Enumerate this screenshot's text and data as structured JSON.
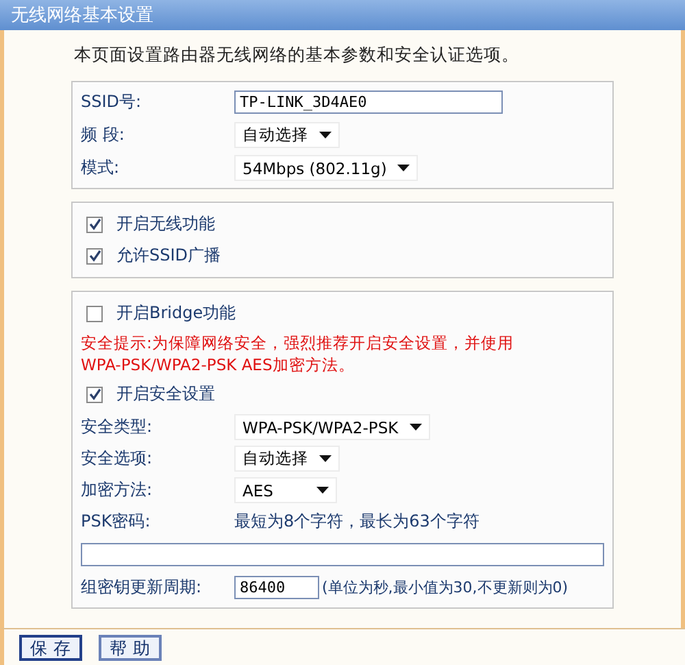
{
  "window": {
    "title": "无线网络基本设置"
  },
  "intro": "本页面设置路由器无线网络的基本参数和安全认证选项。",
  "basic": [
    {
      "kind": "text",
      "label": "SSID号:",
      "value": "TP-LINK_3D4AE0"
    },
    {
      "kind": "select",
      "label": "频 段:",
      "value": "自动选择"
    },
    {
      "kind": "select",
      "label": "模式:",
      "value": "54Mbps (802.11g)"
    }
  ],
  "switches": [
    {
      "label": "开启无线功能",
      "checked": true
    },
    {
      "label": "允许SSID广播",
      "checked": true
    }
  ],
  "bridge": {
    "label": "开启Bridge功能",
    "checked": false
  },
  "warning": [
    "安全提示:为保障网络安全，强烈推荐开启安全设置，并使用",
    "WPA-PSK/WPA2-PSK AES加密方法。"
  ],
  "security": {
    "label": "开启安全设置",
    "checked": true
  },
  "security_rows": [
    {
      "kind": "select",
      "label": "安全类型:",
      "value": "WPA-PSK/WPA2-PSK"
    },
    {
      "kind": "select",
      "label": "安全选项:",
      "value": "自动选择"
    },
    {
      "kind": "select",
      "label": "加密方法:",
      "value": "AES"
    }
  ],
  "psk": {
    "label": "PSK密码:",
    "hint": "最短为8个字符，最长为63个字符"
  },
  "group_key": {
    "label": "组密钥更新周期:",
    "value": "86400",
    "hint": "(单位为秒,最小值为30,不更新则为0)"
  },
  "buttons": [
    "保 存",
    "帮 助"
  ]
}
